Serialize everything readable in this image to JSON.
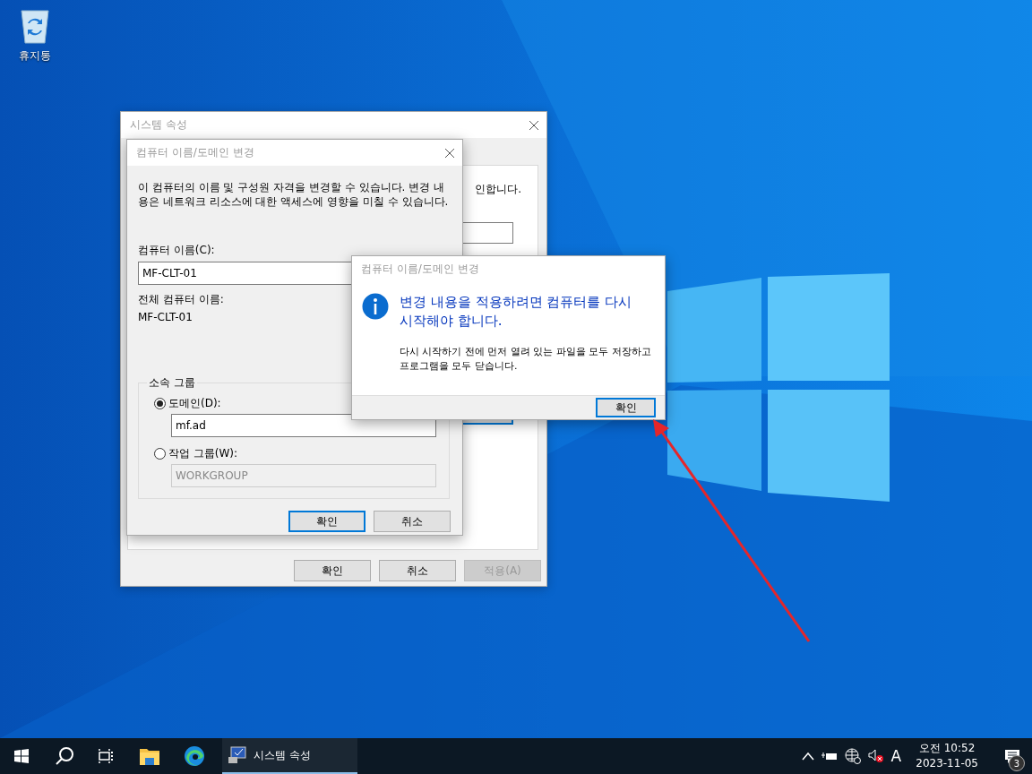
{
  "desktop_icons": [
    {
      "label": "휴지통"
    }
  ],
  "system_properties": {
    "title": "시스템 속성",
    "partial_text": "인합니다.",
    "buttons": [
      {
        "label": "확인",
        "disabled": false
      },
      {
        "label": "취소",
        "disabled": false
      },
      {
        "label": "적용(A)",
        "disabled": true
      }
    ]
  },
  "computer_name_dialog": {
    "title": "컴퓨터 이름/도메인 변경",
    "description": "이 컴퓨터의 이름 및 구성원 자격을 변경할 수 있습니다. 변경 내용은 네트워크 리소스에 대한 액세스에 영향을 미칠 수 있습니다.",
    "computer_name_label": "컴퓨터 이름(C):",
    "computer_name_value": "MF-CLT-01",
    "full_name_label": "전체 컴퓨터 이름:",
    "full_name_value": "MF-CLT-01",
    "member_of": {
      "legend": "소속 그룹",
      "options": [
        {
          "label": "도메인(D):",
          "selected": true,
          "value": "mf.ad",
          "disabled": false
        },
        {
          "label": "작업 그룹(W):",
          "selected": false,
          "value": "WORKGROUP",
          "disabled": true
        }
      ]
    },
    "buttons": [
      {
        "label": "확인",
        "default": true
      },
      {
        "label": "취소",
        "default": false
      }
    ]
  },
  "message_box": {
    "title": "컴퓨터 이름/도메인 변경",
    "heading": "변경 내용을 적용하려면 컴퓨터를 다시 시작해야 합니다.",
    "body": "다시 시작하기 전에 먼저 열려 있는 파일을 모두 저장하고 프로그램을 모두 닫습니다.",
    "button": {
      "label": "확인",
      "default": true
    }
  },
  "taskbar": {
    "apps": [
      {
        "kind": "start"
      },
      {
        "kind": "search"
      },
      {
        "kind": "taskview"
      },
      {
        "kind": "explorer"
      },
      {
        "kind": "edge"
      },
      {
        "kind": "window",
        "label": "시스템 속성",
        "active": true
      }
    ],
    "tray": {
      "ime": "A",
      "time": "오전 10:52",
      "date": "2023-11-05",
      "notifications": "3"
    }
  }
}
